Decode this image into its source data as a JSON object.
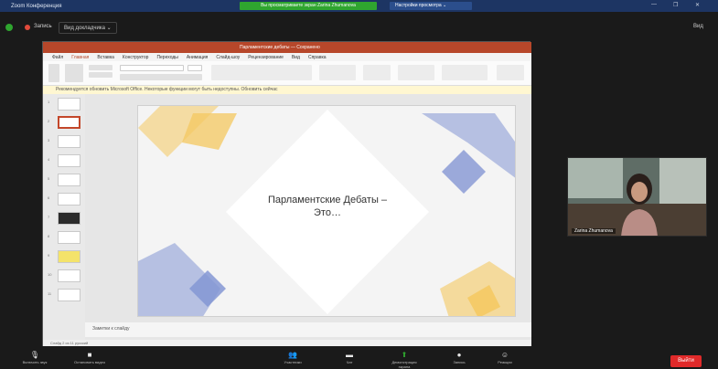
{
  "window": {
    "title": "Zoom Конференция",
    "banner_green": "Вы просматриваете экран Zarina Zhumanova",
    "share_tab": "Настройки просмотра ⌄",
    "controls": [
      "—",
      "❐",
      "✕"
    ]
  },
  "meeting": {
    "badge": "Запись",
    "view_label": "Вид докладчика ⌄",
    "right_label": "Вид"
  },
  "powerpoint": {
    "title": "Парламентские дебаты — Сохранено",
    "tabs": [
      "Файл",
      "Главная",
      "Вставка",
      "Конструктор",
      "Переходы",
      "Анимация",
      "Слайд-шоу",
      "Рецензирование",
      "Вид",
      "Справка"
    ],
    "notice": "Рекомендуется обновить Microsoft Office. Некоторые функции могут быть недоступны. Обновить сейчас",
    "notes_text": "Заметки к слайду",
    "status_text": "Слайд 2 из 11   русский",
    "thumb_numbers": [
      "1",
      "2",
      "3",
      "4",
      "5",
      "6",
      "7",
      "8",
      "9",
      "10",
      "11"
    ],
    "slide_title_line1": "Парламентские Дебаты –",
    "slide_title_line2": "Это…"
  },
  "video": {
    "participant_name": "Zarina Zhumanova"
  },
  "toolbar": {
    "items": [
      {
        "label": "Включить звук",
        "icon": "mic-icon"
      },
      {
        "label": "Остановить видео",
        "icon": "camera-icon"
      },
      {
        "label": "Участники",
        "icon": "participants-icon"
      },
      {
        "label": "Чат",
        "icon": "chat-icon"
      },
      {
        "label": "Демонстрация экрана",
        "icon": "share-icon"
      },
      {
        "label": "Запись",
        "icon": "record-icon"
      },
      {
        "label": "Реакции",
        "icon": "reactions-icon"
      }
    ],
    "leave_label": "Выйти"
  },
  "colors": {
    "powerpoint_orange": "#b7472a",
    "zoom_green": "#2fa52f",
    "leave_red": "#e02a2a",
    "slide_yellow": "#f4c860",
    "slide_blue": "#8496d3"
  }
}
